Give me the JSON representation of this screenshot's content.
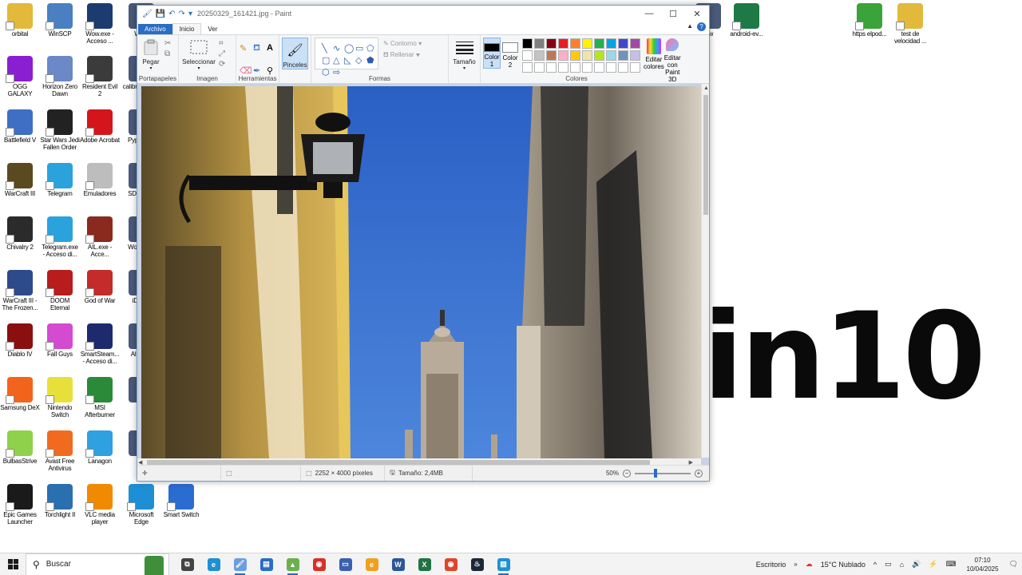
{
  "desktop": {
    "wallpaper_text": "in10",
    "icons": [
      {
        "label": "orbital",
        "icon": "folder-icon",
        "color": "#e2b93b"
      },
      {
        "label": "WinSCP",
        "icon": "winscp-icon",
        "color": "#4a7fc1"
      },
      {
        "label": "Wow.exe - Acceso ...",
        "icon": "wow-icon",
        "color": "#1c3b6e"
      },
      {
        "label": "OGG GALAXY",
        "icon": "gog-galaxy-icon",
        "color": "#8a1fd1"
      },
      {
        "label": "Horizon Zero Dawn",
        "icon": "horizon-icon",
        "color": "#6b88c7"
      },
      {
        "label": "Resident Evil 2",
        "icon": "resident-evil-icon",
        "color": "#3b3b3b"
      },
      {
        "label": "Battlefield V",
        "icon": "battlefield-icon",
        "color": "#3e6fc4"
      },
      {
        "label": "Star Wars Jedi Fallen Order",
        "icon": "star-wars-icon",
        "color": "#222222"
      },
      {
        "label": "Adobe Acrobat",
        "icon": "acrobat-icon",
        "color": "#d4161c"
      },
      {
        "label": "WarCraft III",
        "icon": "warcraft-icon",
        "color": "#5a4a1f"
      },
      {
        "label": "Telegram",
        "icon": "telegram-icon",
        "color": "#2aa3dd"
      },
      {
        "label": "Emuladores",
        "icon": "emulators-icon",
        "color": "#bdbdbd"
      },
      {
        "label": "Chivalry 2",
        "icon": "chivalry-icon",
        "color": "#2b2b2b"
      },
      {
        "label": "Telegram.exe - Acceso di...",
        "icon": "telegram-icon",
        "color": "#2aa3dd"
      },
      {
        "label": "AIL.exe - Acce...",
        "icon": "ail-icon",
        "color": "#8a2a1e"
      },
      {
        "label": "WarCraft III - The Frozen...",
        "icon": "warcraft-frozen-icon",
        "color": "#2d4a8a"
      },
      {
        "label": "DOOM Eternal",
        "icon": "doom-icon",
        "color": "#b81c1c"
      },
      {
        "label": "God of War",
        "icon": "god-of-war-icon",
        "color": "#c42b2b"
      },
      {
        "label": "Diablo IV",
        "icon": "diablo-icon",
        "color": "#8a1010"
      },
      {
        "label": "Fall Guys",
        "icon": "fall-guys-icon",
        "color": "#d44ad1"
      },
      {
        "label": "SmartSteam... - Acceso di...",
        "icon": "smartsteam-icon",
        "color": "#1e2a6e"
      },
      {
        "label": "Samsung DeX",
        "icon": "samsung-dex-icon",
        "color": "#f2641c"
      },
      {
        "label": "Nintendo Switch",
        "icon": "nintendo-switch-icon",
        "color": "#e8e03a"
      },
      {
        "label": "MSI Afterburner",
        "icon": "msi-afterburner-icon",
        "color": "#2a8a3a"
      },
      {
        "label": "BulbasStrive",
        "icon": "bulbastrive-icon",
        "color": "#8fd14a"
      },
      {
        "label": "Avast Free Antivirus",
        "icon": "avast-icon",
        "color": "#f06b1f"
      },
      {
        "label": "Lanagon",
        "icon": "lanagon-icon",
        "color": "#2fa0e0"
      },
      {
        "label": "Epic Games Launcher",
        "icon": "epic-games-icon",
        "color": "#1a1a1a"
      },
      {
        "label": "Torchlight II",
        "icon": "torchlight-icon",
        "color": "#2a6fb0"
      },
      {
        "label": "VLC media player",
        "icon": "vlc-icon",
        "color": "#f08a00"
      },
      {
        "label": "Microsoft Edge",
        "icon": "edge-icon",
        "color": "#1e8fd4"
      },
      {
        "label": "Smart Switch",
        "icon": "smart-switch-icon",
        "color": "#2b6cd1"
      },
      {
        "label": "android-ev...",
        "icon": "excel-file-icon",
        "color": "#1d7a45"
      },
      {
        "label": "https elpod...",
        "icon": "web-shortcut-icon",
        "color": "#3aa33a"
      },
      {
        "label": "test de velocidad ...",
        "icon": "folder-icon",
        "color": "#e2b93b"
      }
    ],
    "partial_labels": [
      "Wo...",
      "calibr... e bo...",
      "Pyp... re...",
      "SD... Fo...",
      "Wo... co...",
      "iDow...",
      "Al... D...",
      "St...",
      "S...",
      "rew"
    ]
  },
  "paint": {
    "title": "20250329_161421.jpg - Paint",
    "tabs": {
      "file": "Archivo",
      "home": "Inicio",
      "view": "Ver"
    },
    "clipboard": {
      "paste": "Pegar",
      "group": "Portapapeles"
    },
    "image": {
      "select": "Seleccionar",
      "group": "Imagen"
    },
    "tools": {
      "group": "Herramientas"
    },
    "brushes": "Pinceles",
    "shapes": {
      "outline": "Contorno",
      "fill": "Rellenar",
      "group": "Formas"
    },
    "size": "Tamaño",
    "colors": {
      "color1": "Color 1",
      "color2": "Color 2",
      "edit": "Editar colores",
      "paint3d": "Editar con Paint 3D",
      "group": "Colores",
      "color1_value": "#000000",
      "color2_value": "#ffffff",
      "palette": [
        "#000000",
        "#7f7f7f",
        "#880015",
        "#ed1c24",
        "#ff7f27",
        "#fff200",
        "#22b14c",
        "#00a2e8",
        "#3f48cc",
        "#a349a4",
        "#ffffff",
        "#c3c3c3",
        "#b97a57",
        "#ffaec9",
        "#ffc90e",
        "#efe4b0",
        "#b5e61d",
        "#99d9ea",
        "#7092be",
        "#c8bfe7",
        "#ffffff",
        "#ffffff",
        "#ffffff",
        "#ffffff",
        "#ffffff",
        "#ffffff",
        "#ffffff",
        "#ffffff",
        "#ffffff",
        "#ffffff"
      ]
    },
    "status": {
      "dimensions": "2252 × 4000 píxeles",
      "size": "Tamaño: 2,4MB",
      "zoom": "50%"
    }
  },
  "taskbar": {
    "search_placeholder": "Buscar",
    "desktop_label": "Escritorio",
    "weather": "15°C  Nublado",
    "time": "07:10",
    "date": "10/04/2025"
  }
}
